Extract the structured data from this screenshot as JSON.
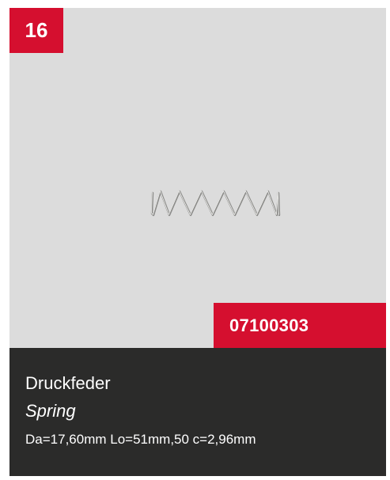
{
  "product": {
    "position_number": "16",
    "article_number": "07100303",
    "name_de": "Druckfeder",
    "name_en": "Spring",
    "specs": "Da=17,60mm Lo=51mm,50 c=2,96mm",
    "image_icon": "compression-spring-icon"
  },
  "colors": {
    "accent": "#d50f2f",
    "image_background": "#dcdcdc",
    "info_background": "#2b2b2a",
    "text": "#ffffff"
  }
}
